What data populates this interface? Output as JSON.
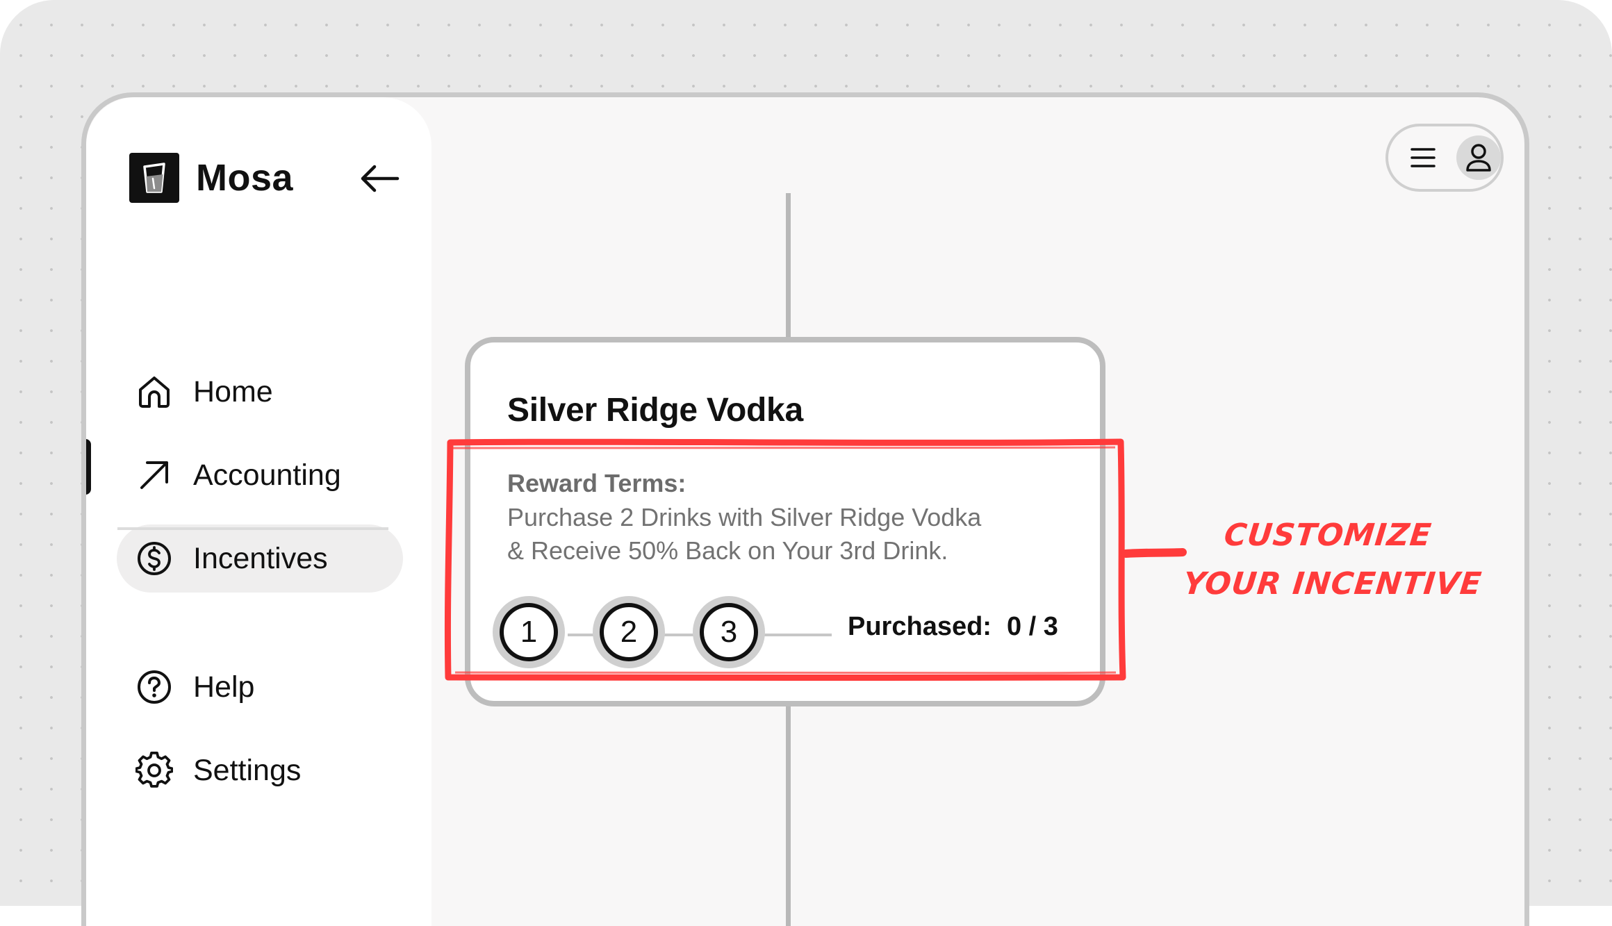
{
  "app": {
    "name": "Mosa"
  },
  "sidebar": {
    "items": [
      {
        "label": "Home",
        "icon": "home-icon"
      },
      {
        "label": "Accounting",
        "icon": "arrow-up-right-icon"
      },
      {
        "label": "Incentives",
        "icon": "dollar-circle-icon",
        "active": true
      },
      {
        "label": "Help",
        "icon": "question-circle-icon"
      },
      {
        "label": "Settings",
        "icon": "gear-icon"
      }
    ]
  },
  "incentive_card": {
    "title": "Silver Ridge Vodka",
    "terms_label": "Reward Terms:",
    "terms_line1": "Purchase 2 Drinks with Silver Ridge Vodka",
    "terms_line2": "& Receive 50% Back on Your 3rd Drink.",
    "steps": [
      "1",
      "2",
      "3"
    ],
    "purchased_label": "Purchased:",
    "purchased_count": "0 / 3"
  },
  "annotation": {
    "line1": "CUSTOMIZE",
    "line2": "YOUR INCENTIVE",
    "color": "#ff3b3b"
  }
}
